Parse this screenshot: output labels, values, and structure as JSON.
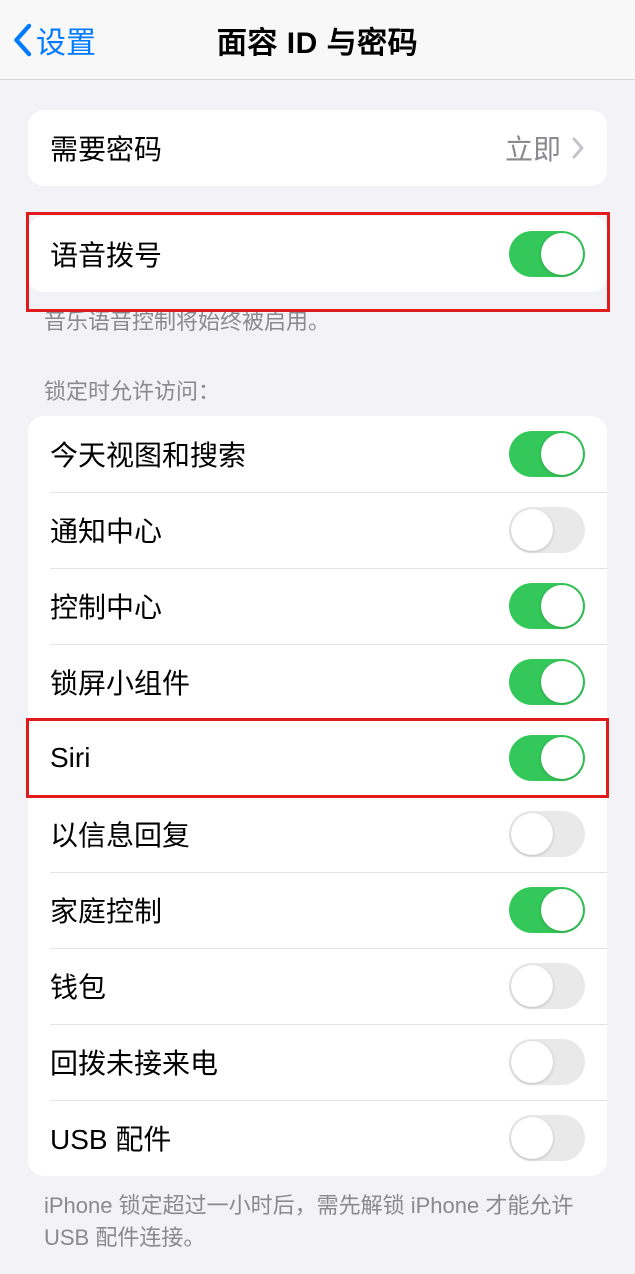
{
  "nav": {
    "back_label": "设置",
    "title": "面容 ID 与密码"
  },
  "require_passcode": {
    "label": "需要密码",
    "value": "立即"
  },
  "voice_dial": {
    "label": "语音拨号",
    "on": true,
    "footer": "音乐语音控制将始终被启用。"
  },
  "locked_access": {
    "header": "锁定时允许访问：",
    "items": [
      {
        "label": "今天视图和搜索",
        "on": true
      },
      {
        "label": "通知中心",
        "on": false
      },
      {
        "label": "控制中心",
        "on": true
      },
      {
        "label": "锁屏小组件",
        "on": true
      },
      {
        "label": "Siri",
        "on": true
      },
      {
        "label": "以信息回复",
        "on": false
      },
      {
        "label": "家庭控制",
        "on": true
      },
      {
        "label": "钱包",
        "on": false
      },
      {
        "label": "回拨未接来电",
        "on": false
      },
      {
        "label": "USB 配件",
        "on": false
      }
    ],
    "footer": "iPhone 锁定超过一小时后，需先解锁 iPhone 才能允许USB 配件连接。"
  },
  "highlight_colors": {
    "red": "#e11b1b"
  }
}
